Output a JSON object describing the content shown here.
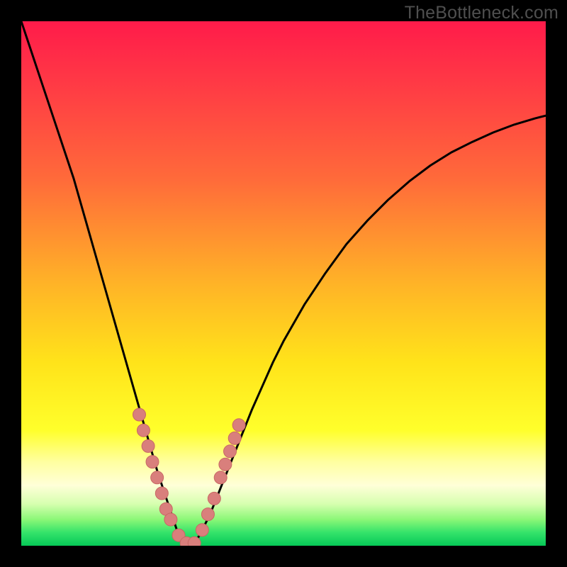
{
  "watermark": "TheBottleneck.com",
  "colors": {
    "frame": "#000000",
    "curve": "#000000",
    "marker_fill": "#d97f7c",
    "marker_stroke": "#c86864",
    "gradient_stops": [
      {
        "offset": 0.0,
        "color": "#ff1b4a"
      },
      {
        "offset": 0.12,
        "color": "#ff3a45"
      },
      {
        "offset": 0.3,
        "color": "#ff6a3a"
      },
      {
        "offset": 0.5,
        "color": "#ffb327"
      },
      {
        "offset": 0.65,
        "color": "#ffe31a"
      },
      {
        "offset": 0.78,
        "color": "#ffff2b"
      },
      {
        "offset": 0.84,
        "color": "#ffffa0"
      },
      {
        "offset": 0.885,
        "color": "#ffffd8"
      },
      {
        "offset": 0.92,
        "color": "#d7ffb0"
      },
      {
        "offset": 0.95,
        "color": "#8bf777"
      },
      {
        "offset": 0.975,
        "color": "#34e36a"
      },
      {
        "offset": 1.0,
        "color": "#06c957"
      }
    ]
  },
  "chart_data": {
    "type": "line",
    "title": "",
    "xlabel": "",
    "ylabel": "",
    "xlim": [
      0,
      100
    ],
    "ylim": [
      0,
      100
    ],
    "x": [
      0,
      2,
      4,
      6,
      8,
      10,
      12,
      14,
      16,
      18,
      20,
      22,
      24,
      26,
      28,
      29,
      30,
      31,
      32,
      33,
      34,
      36,
      38,
      40,
      42,
      44,
      46,
      48,
      50,
      54,
      58,
      62,
      66,
      70,
      74,
      78,
      82,
      86,
      90,
      94,
      98,
      100
    ],
    "y": [
      100,
      94,
      88,
      82,
      76,
      70,
      63,
      56,
      49,
      42,
      35,
      28,
      21,
      14,
      8,
      5,
      2,
      0.5,
      0,
      0.5,
      2,
      6,
      11,
      16,
      21,
      26,
      30.5,
      35,
      39,
      46,
      52,
      57.5,
      62,
      66,
      69.5,
      72.5,
      75,
      77,
      78.8,
      80.3,
      81.5,
      82
    ],
    "markers": {
      "x": [
        22.5,
        23.3,
        24.2,
        25.0,
        25.9,
        26.8,
        27.6,
        28.5,
        30.0,
        31.5,
        33.0,
        34.5,
        35.6,
        36.8,
        38.0,
        38.9,
        39.8,
        40.7,
        41.5
      ],
      "y": [
        25,
        22,
        19,
        16,
        13,
        10,
        7,
        5,
        2,
        0.5,
        0.5,
        3,
        6,
        9,
        13,
        15.5,
        18,
        20.5,
        23
      ]
    }
  }
}
